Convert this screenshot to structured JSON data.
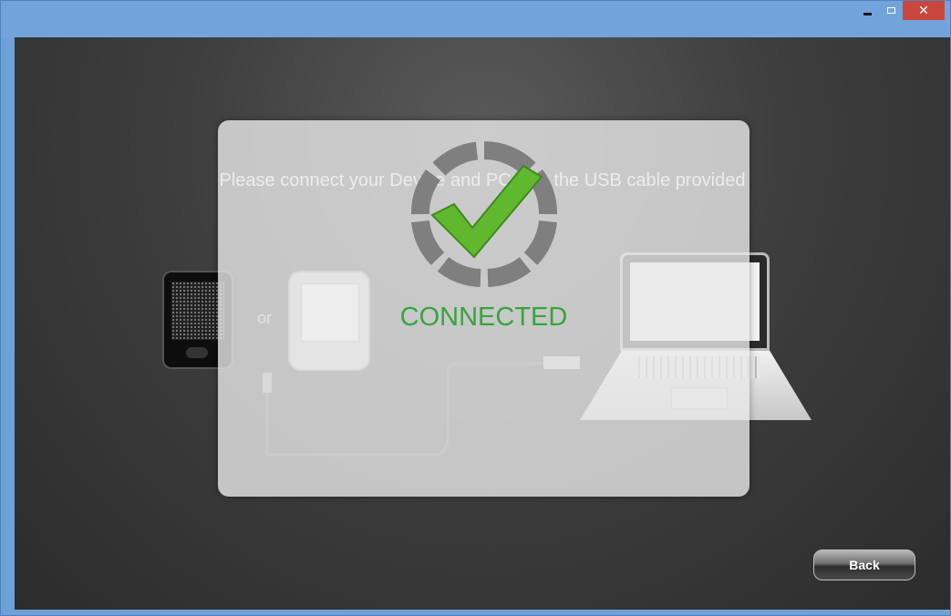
{
  "window": {
    "controls": {
      "minimize_icon": "minimize-icon",
      "maximize_icon": "maximize-icon",
      "close_icon": "close-icon",
      "close_glyph": "✕"
    }
  },
  "main": {
    "instruction": "Please connect your Device and PC with the USB cable provided",
    "or_label": "or",
    "devices": [
      "speaker-device",
      "tablet-device",
      "laptop-computer"
    ]
  },
  "overlay": {
    "status_text": "CONNECTED",
    "status_icon": "check-icon",
    "status_color": "#36a53d"
  },
  "footer": {
    "back_label": "Back"
  },
  "colors": {
    "titlebar": "#72a4db",
    "close_button": "#c9463d",
    "content_bg": "#3e3e3e",
    "check": "#5fb82e",
    "ring": "#7f7f7f"
  }
}
